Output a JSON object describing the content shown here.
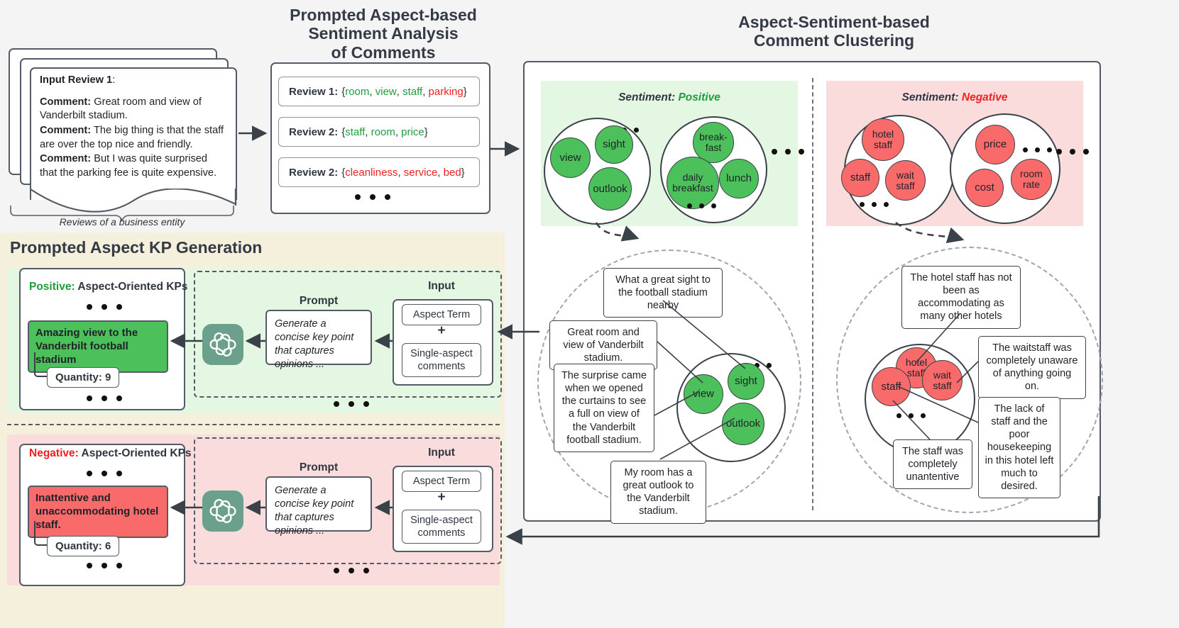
{
  "sections": {
    "absa_title": "Prompted Aspect-based\nSentiment Analysis\nof Comments",
    "absa_title_l1": "Prompted Aspect-based",
    "absa_title_l2": "Sentiment Analysis",
    "absa_title_l3": "of Comments",
    "cluster_title_l1": "Aspect-Sentiment-based",
    "cluster_title_l2": "Comment Clustering",
    "kpgen_title": "Prompted Aspect KP Generation"
  },
  "input_reviews": {
    "heading_label": "Input Review 1",
    "heading_colon": ":",
    "comment_label": "Comment:",
    "comments": [
      "Great room and view of Vanderbilt stadium.",
      "The big thing is that the staff are over the top nice and friendly.",
      "But I was quite surprised that the parking fee is quite expensive."
    ],
    "caption": "Reviews of a business entity"
  },
  "absa": {
    "rows": [
      {
        "label": "Review 1:",
        "terms": [
          {
            "text": "room",
            "sentiment": "positive"
          },
          {
            "text": "view",
            "sentiment": "positive"
          },
          {
            "text": "staff",
            "sentiment": "positive"
          },
          {
            "text": "parking",
            "sentiment": "negative"
          }
        ]
      },
      {
        "label": "Review 2:",
        "terms": [
          {
            "text": "staff",
            "sentiment": "positive"
          },
          {
            "text": "room",
            "sentiment": "positive"
          },
          {
            "text": "price",
            "sentiment": "positive"
          }
        ]
      },
      {
        "label": "Review 2:",
        "terms": [
          {
            "text": "cleanliness",
            "sentiment": "negative"
          },
          {
            "text": "service",
            "sentiment": "negative"
          },
          {
            "text": "bed",
            "sentiment": "negative"
          }
        ]
      }
    ]
  },
  "clustering": {
    "positive": {
      "sentiment_prefix": "Sentiment:",
      "sentiment_value": "Positive",
      "clusters": [
        {
          "nodes": [
            "view",
            "sight",
            "outlook"
          ]
        },
        {
          "nodes": [
            "break-\nfast",
            "daily\nbreakfast",
            "lunch"
          ]
        }
      ],
      "cluster1_nodes": [
        "view",
        "sight",
        "outlook"
      ],
      "cluster2_nodes": [
        "break-",
        "fast",
        "daily",
        "breakfast",
        "lunch"
      ]
    },
    "negative": {
      "sentiment_prefix": "Sentiment:",
      "sentiment_value": "Negative",
      "cluster1_nodes": [
        "hotel staff",
        "staff",
        "wait staff"
      ],
      "cluster2_nodes": [
        "price",
        "cost",
        "room rate"
      ]
    }
  },
  "detail_positive": {
    "nodes": [
      "view",
      "sight",
      "outlook"
    ],
    "comments": [
      "What a great sight to the football stadium nearby",
      "Great room and view of Vanderbilt stadium.",
      "The surprise came when we opened the curtains to see a full on view of the Vanderbilt football stadium.",
      "My room has a great outlook to the Vanderbilt stadium."
    ]
  },
  "detail_negative": {
    "nodes": [
      "hotel staff",
      "staff",
      "wait staff"
    ],
    "comments": [
      "The hotel staff has not been as accommodating as many other hotels",
      "The waitstaff was completely unaware of anything going on.",
      "The lack of staff and the poor housekeeping in this hotel left much to desired.",
      "The staff was completely unantentive"
    ]
  },
  "kp_generation": {
    "positive": {
      "header_label": "Positive:",
      "header_rest": "Aspect-Oriented KPs",
      "kp_text": "Amazing view to the Vanderbilt football stadium",
      "quantity_label": "Quantity: 9",
      "prompt_label": "Prompt",
      "prompt_text": "Generate a concise key point that captures opinions ...",
      "input_label": "Input",
      "input_aspect": "Aspect Term",
      "input_plus": "+",
      "input_comments": "Single-aspect comments",
      "model_icon": "openai-logo-icon"
    },
    "negative": {
      "header_label": "Negative:",
      "header_rest": "Aspect-Oriented KPs",
      "kp_text": "Inattentive and unaccommodating hotel staff.",
      "quantity_label": "Quantity: 6",
      "prompt_label": "Prompt",
      "prompt_text": "Generate a concise key point that captures opinions ...",
      "input_label": "Input",
      "input_aspect": "Aspect Term",
      "input_plus": "+",
      "input_comments": "Single-aspect comments",
      "model_icon": "openai-logo-icon"
    }
  },
  "colors": {
    "positive_green": "#4cc05a",
    "negative_red": "#f96a6a",
    "positive_text": "#1f9d3d",
    "negative_text": "#ef2020",
    "panel_border": "#555b66",
    "band_cream": "#f5f0db",
    "band_green": "#e3f7e3",
    "band_red": "#fbdcdc",
    "page_bg": "#f4f4f4"
  }
}
